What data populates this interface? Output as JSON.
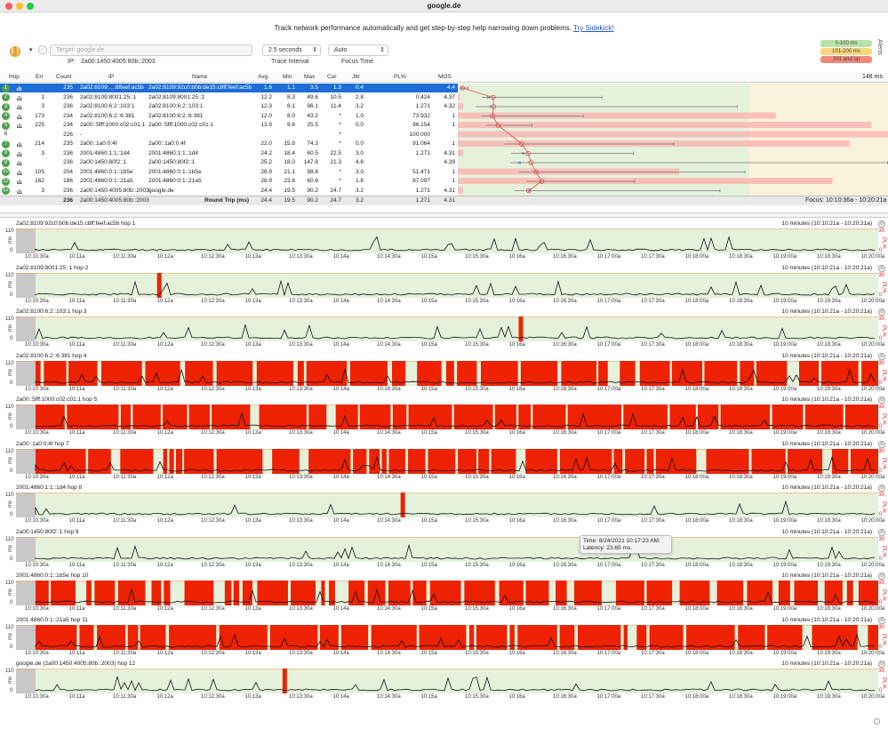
{
  "window": {
    "title": "google.de"
  },
  "banner": {
    "text": "Track network performance automatically and get step-by-step help narrowing down problems.",
    "link": "Try Sidekick!"
  },
  "controls": {
    "target_placeholder": "Target: google.de",
    "interval_value": "2.5 seconds",
    "interval_label": "Trace Interval",
    "focus_value": "Auto",
    "focus_label": "Focus Time",
    "ip_label": "IP:",
    "ip_value": "2a00:1450:4005:80b::2003"
  },
  "legend": [
    {
      "label": "0-100 ms",
      "color": "#b9e3a6"
    },
    {
      "label": "101-200 ms",
      "color": "#f6d77d"
    },
    {
      "label": "201 and up",
      "color": "#f08a7e"
    }
  ],
  "alerts_label": "Alerts",
  "columns": [
    "Hop",
    "Err",
    "Count",
    "IP",
    "Name",
    "Avg",
    "Min",
    "Max",
    "Cur",
    "Jttr",
    "PL%",
    "MOS"
  ],
  "graph_max": "148 ms",
  "hops": [
    {
      "hop": "1",
      "err": "",
      "count": "235",
      "ip": "2a02:8109:...:8ffeef:ac5b",
      "name": "2a02:8109:92c0:b0b:de15:c8ff:feef:ac5b",
      "avg": "1.6",
      "min": "1.1",
      "max": "3.5",
      "cur": "1.3",
      "jttr": "0.4",
      "pl": "",
      "mos": "4.4",
      "selected": true,
      "badge": true
    },
    {
      "hop": "2",
      "err": "1",
      "count": "236",
      "ip": "2a02:8109:8001:25::1",
      "name": "2a02:8109:8001:25::1",
      "avg": "12.2",
      "min": "8.3",
      "max": "49.6",
      "cur": "10.5",
      "jttr": "2.8",
      "pl": "0.424",
      "mos": "4.37",
      "badge": true
    },
    {
      "hop": "3",
      "err": "3",
      "count": "236",
      "ip": "2a02:8100:6:2::103:1",
      "name": "2a02:8100:6:2::103:1",
      "avg": "12.3",
      "min": "6.1",
      "max": "96.1",
      "cur": "11.4",
      "jttr": "3.2",
      "pl": "1.271",
      "mos": "4.32",
      "badge": true
    },
    {
      "hop": "4",
      "err": "173",
      "count": "234",
      "ip": "2a02:8100:6:2::6:381",
      "name": "2a02:8100:6:2::6:381",
      "avg": "12.0",
      "min": "8.0",
      "max": "43.2",
      "cur": "*",
      "jttr": "1.0",
      "pl": "73.932",
      "mos": "1",
      "badge": true
    },
    {
      "hop": "5",
      "err": "225",
      "count": "234",
      "ip": "2a00::5fff:1000:c02:c01:1",
      "name": "2a00::5fff:1000:c02:c01:1",
      "avg": "13.9",
      "min": "9.6",
      "max": "25.5",
      "cur": "*",
      "jttr": "0.0",
      "pl": "96.154",
      "mos": "1",
      "badge": true
    },
    {
      "hop": "6",
      "err": "",
      "count": "226",
      "ip": "-",
      "name": "",
      "avg": "",
      "min": "",
      "max": "",
      "cur": "*",
      "jttr": "",
      "pl": "100.000",
      "mos": "",
      "badge": false
    },
    {
      "hop": "7",
      "err": "214",
      "count": "235",
      "ip": "2a00::1a0:0:4f",
      "name": "2a00::1a0:0:4f",
      "avg": "22.0",
      "min": "15.8",
      "max": "74.3",
      "cur": "*",
      "jttr": "0.0",
      "pl": "91.064",
      "mos": "1",
      "badge": true
    },
    {
      "hop": "8",
      "err": "3",
      "count": "236",
      "ip": "2001:4860:1:1::1d4",
      "name": "2001:4860:1:1::1d4",
      "avg": "24.2",
      "min": "18.4",
      "max": "60.5",
      "cur": "22.5",
      "jttr": "3.0",
      "pl": "1.271",
      "mos": "4.31",
      "badge": true
    },
    {
      "hop": "9",
      "err": "",
      "count": "236",
      "ip": "2a00:1450:80f2::1",
      "name": "2a00:1450:80f2::1",
      "avg": "25.2",
      "min": "18.0",
      "max": "147.8",
      "cur": "21.3",
      "jttr": "4.6",
      "pl": "",
      "mos": "4.39",
      "badge": true
    },
    {
      "hop": "10",
      "err": "105",
      "count": "204",
      "ip": "2001:4860:0:1::1b5e",
      "name": "2001:4860:0:1::1b5e",
      "avg": "26.9",
      "min": "21.1",
      "max": "98.8",
      "cur": "*",
      "jttr": "3.0",
      "pl": "51.471",
      "mos": "1",
      "badge": true
    },
    {
      "hop": "11",
      "err": "162",
      "count": "186",
      "ip": "2001:4860:0:1::21a5",
      "name": "2001:4860:0:1::21a5",
      "avg": "28.9",
      "min": "23.6",
      "max": "60.8",
      "cur": "*",
      "jttr": "1.8",
      "pl": "87.097",
      "mos": "1",
      "badge": true
    },
    {
      "hop": "12",
      "err": "3",
      "count": "236",
      "ip": "2a00:1450:4005:80b::2003",
      "name": "google.de",
      "avg": "24.4",
      "min": "19.5",
      "max": "90.2",
      "cur": "24.7",
      "jttr": "3.2",
      "pl": "1.271",
      "mos": "4.31",
      "badge": true
    }
  ],
  "round_trip": {
    "count": "236",
    "ip": "2a00:1450:4005:80b::2003",
    "label": "Round Trip (ms)",
    "avg": "24.4",
    "min": "19.5",
    "max": "90.2",
    "cur": "24.7",
    "jttr": "3.2",
    "pl": "1.271",
    "mos": "4.31"
  },
  "focus_label": "Focus: 10:10:36a - 10:20:21a",
  "time_ticks": [
    "10:10:30a",
    "10:11a",
    "10:11:30a",
    "10:12a",
    "10:12:30a",
    "10:13a",
    "10:13:30a",
    "10:14a",
    "10:14:30a",
    "10:15a",
    "10:15:30a",
    "10:16a",
    "10:16:30a",
    "10:17:00a",
    "10:17:30a",
    "10:18:00a",
    "10:18:30a",
    "10:19:00a",
    "10:19:30a",
    "10:20:00a"
  ],
  "panel_range": "10 minutes (10:10:21a - 10:20:21a)",
  "y_labels": {
    "ms_top": "110",
    "ms_zero": "0",
    "pl_top": "30",
    "pl_zero": "0",
    "ms_axis": "ms",
    "pl_axis": "PL%"
  },
  "panels": [
    {
      "title": "2a02:8109:92c0:b0b:de15:c8ff:feef:ac5b hop 1",
      "loss_pct": 0
    },
    {
      "title": "2a02:8109:8001:25::1 hop 2",
      "loss_pct": 0.424
    },
    {
      "title": "2a02:8100:6:2::103:1 hop 3",
      "loss_pct": 1.271
    },
    {
      "title": "2a02:8100:6:2::6:381 hop 4",
      "loss_pct": 73.932
    },
    {
      "title": "2a00::5fff:1000:c02:c01:1 hop 5",
      "loss_pct": 96.154
    },
    {
      "title": "2a00::1a0:0:4f hop 7",
      "loss_pct": 91.064
    },
    {
      "title": "2001:4860:1:1::1d4 hop 8",
      "loss_pct": 1.271
    },
    {
      "title": "2a00:1450:80f2::1 hop 9",
      "loss_pct": 0
    },
    {
      "title": "2001:4860:0:1::1b5e hop 10",
      "loss_pct": 51.471
    },
    {
      "title": "2001:4860:0:1::21a5 hop 11",
      "loss_pct": 87.097
    },
    {
      "title": "google.de (2a00:1450:4005:80b::2003) hop 12",
      "loss_pct": 1.271
    }
  ],
  "tooltip": {
    "time": "Time: 8/24/2021 10:17:23 AM.",
    "latency": "Latency: 23.65 ms."
  },
  "colors": {
    "loss": "#ee2200",
    "good_zone": "#e6f1dc",
    "warn_zone": "#fbf2dc",
    "selected": "#1c6ed4"
  }
}
